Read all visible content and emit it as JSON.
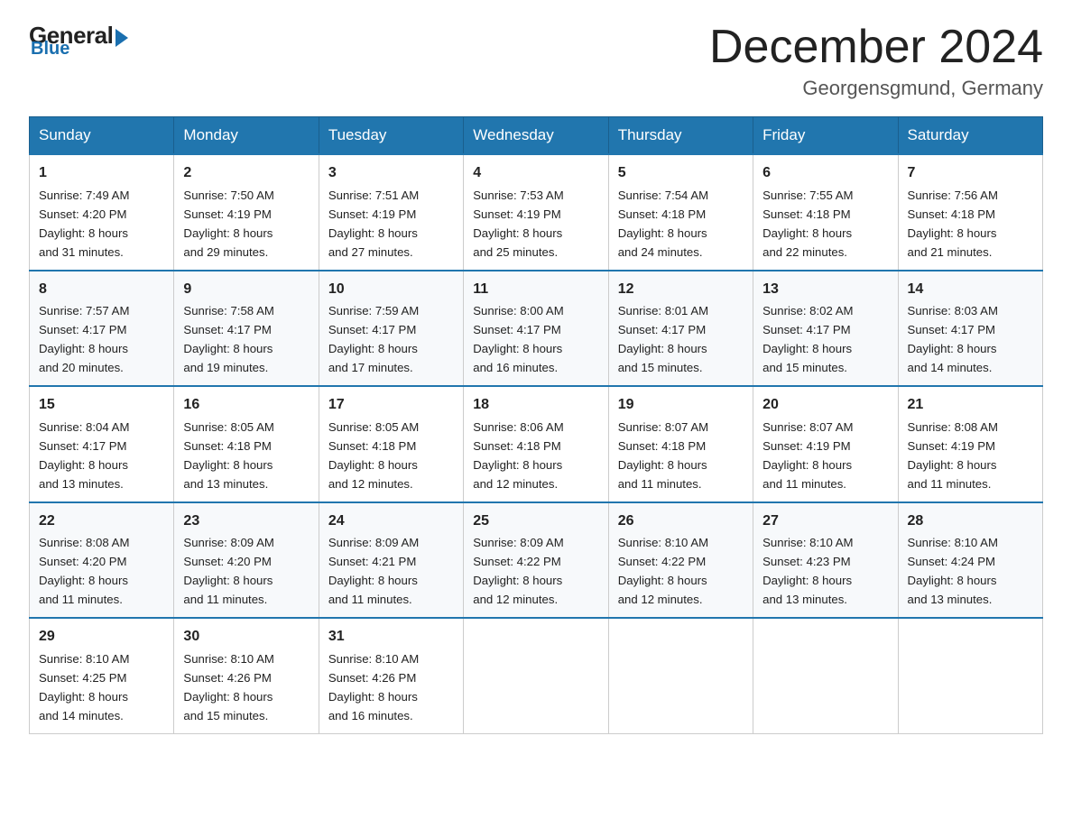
{
  "logo": {
    "general": "General",
    "blue": "Blue"
  },
  "header": {
    "month": "December 2024",
    "location": "Georgensgmund, Germany"
  },
  "days_of_week": [
    "Sunday",
    "Monday",
    "Tuesday",
    "Wednesday",
    "Thursday",
    "Friday",
    "Saturday"
  ],
  "weeks": [
    [
      {
        "day": "1",
        "sunrise": "7:49 AM",
        "sunset": "4:20 PM",
        "daylight": "8 hours and 31 minutes."
      },
      {
        "day": "2",
        "sunrise": "7:50 AM",
        "sunset": "4:19 PM",
        "daylight": "8 hours and 29 minutes."
      },
      {
        "day": "3",
        "sunrise": "7:51 AM",
        "sunset": "4:19 PM",
        "daylight": "8 hours and 27 minutes."
      },
      {
        "day": "4",
        "sunrise": "7:53 AM",
        "sunset": "4:19 PM",
        "daylight": "8 hours and 25 minutes."
      },
      {
        "day": "5",
        "sunrise": "7:54 AM",
        "sunset": "4:18 PM",
        "daylight": "8 hours and 24 minutes."
      },
      {
        "day": "6",
        "sunrise": "7:55 AM",
        "sunset": "4:18 PM",
        "daylight": "8 hours and 22 minutes."
      },
      {
        "day": "7",
        "sunrise": "7:56 AM",
        "sunset": "4:18 PM",
        "daylight": "8 hours and 21 minutes."
      }
    ],
    [
      {
        "day": "8",
        "sunrise": "7:57 AM",
        "sunset": "4:17 PM",
        "daylight": "8 hours and 20 minutes."
      },
      {
        "day": "9",
        "sunrise": "7:58 AM",
        "sunset": "4:17 PM",
        "daylight": "8 hours and 19 minutes."
      },
      {
        "day": "10",
        "sunrise": "7:59 AM",
        "sunset": "4:17 PM",
        "daylight": "8 hours and 17 minutes."
      },
      {
        "day": "11",
        "sunrise": "8:00 AM",
        "sunset": "4:17 PM",
        "daylight": "8 hours and 16 minutes."
      },
      {
        "day": "12",
        "sunrise": "8:01 AM",
        "sunset": "4:17 PM",
        "daylight": "8 hours and 15 minutes."
      },
      {
        "day": "13",
        "sunrise": "8:02 AM",
        "sunset": "4:17 PM",
        "daylight": "8 hours and 15 minutes."
      },
      {
        "day": "14",
        "sunrise": "8:03 AM",
        "sunset": "4:17 PM",
        "daylight": "8 hours and 14 minutes."
      }
    ],
    [
      {
        "day": "15",
        "sunrise": "8:04 AM",
        "sunset": "4:17 PM",
        "daylight": "8 hours and 13 minutes."
      },
      {
        "day": "16",
        "sunrise": "8:05 AM",
        "sunset": "4:18 PM",
        "daylight": "8 hours and 13 minutes."
      },
      {
        "day": "17",
        "sunrise": "8:05 AM",
        "sunset": "4:18 PM",
        "daylight": "8 hours and 12 minutes."
      },
      {
        "day": "18",
        "sunrise": "8:06 AM",
        "sunset": "4:18 PM",
        "daylight": "8 hours and 12 minutes."
      },
      {
        "day": "19",
        "sunrise": "8:07 AM",
        "sunset": "4:18 PM",
        "daylight": "8 hours and 11 minutes."
      },
      {
        "day": "20",
        "sunrise": "8:07 AM",
        "sunset": "4:19 PM",
        "daylight": "8 hours and 11 minutes."
      },
      {
        "day": "21",
        "sunrise": "8:08 AM",
        "sunset": "4:19 PM",
        "daylight": "8 hours and 11 minutes."
      }
    ],
    [
      {
        "day": "22",
        "sunrise": "8:08 AM",
        "sunset": "4:20 PM",
        "daylight": "8 hours and 11 minutes."
      },
      {
        "day": "23",
        "sunrise": "8:09 AM",
        "sunset": "4:20 PM",
        "daylight": "8 hours and 11 minutes."
      },
      {
        "day": "24",
        "sunrise": "8:09 AM",
        "sunset": "4:21 PM",
        "daylight": "8 hours and 11 minutes."
      },
      {
        "day": "25",
        "sunrise": "8:09 AM",
        "sunset": "4:22 PM",
        "daylight": "8 hours and 12 minutes."
      },
      {
        "day": "26",
        "sunrise": "8:10 AM",
        "sunset": "4:22 PM",
        "daylight": "8 hours and 12 minutes."
      },
      {
        "day": "27",
        "sunrise": "8:10 AM",
        "sunset": "4:23 PM",
        "daylight": "8 hours and 13 minutes."
      },
      {
        "day": "28",
        "sunrise": "8:10 AM",
        "sunset": "4:24 PM",
        "daylight": "8 hours and 13 minutes."
      }
    ],
    [
      {
        "day": "29",
        "sunrise": "8:10 AM",
        "sunset": "4:25 PM",
        "daylight": "8 hours and 14 minutes."
      },
      {
        "day": "30",
        "sunrise": "8:10 AM",
        "sunset": "4:26 PM",
        "daylight": "8 hours and 15 minutes."
      },
      {
        "day": "31",
        "sunrise": "8:10 AM",
        "sunset": "4:26 PM",
        "daylight": "8 hours and 16 minutes."
      },
      null,
      null,
      null,
      null
    ]
  ],
  "labels": {
    "sunrise": "Sunrise:",
    "sunset": "Sunset:",
    "daylight": "Daylight:"
  }
}
